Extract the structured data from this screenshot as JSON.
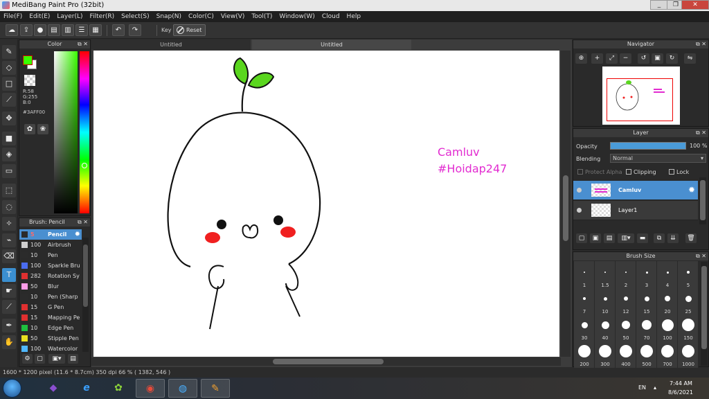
{
  "window": {
    "title": "MediBang Paint Pro (32bit)",
    "controls": [
      "_",
      "❐",
      "✕"
    ]
  },
  "menu": [
    "File(F)",
    "Edit(E)",
    "Layer(L)",
    "Filter(R)",
    "Select(S)",
    "Snap(N)",
    "Color(C)",
    "View(V)",
    "Tool(T)",
    "Window(W)",
    "Cloud",
    "Help"
  ],
  "toolbar": {
    "key_label": "Key",
    "reset_label": "Reset"
  },
  "color_panel": {
    "title": "Color",
    "r": "R:58",
    "g": "G:255",
    "b": "B:0",
    "hex": "#3AFF00",
    "fg_color": "#3aff00"
  },
  "brush_panel": {
    "title": "Brush: Pencil",
    "items": [
      {
        "size": "5",
        "name": "Pencil",
        "color": "#2b2b2b",
        "selected": true
      },
      {
        "size": "100",
        "name": "Airbrush",
        "color": "#cfcfcf"
      },
      {
        "size": "10",
        "name": "Pen",
        "color": "#2b2b2b"
      },
      {
        "size": "100",
        "name": "Sparkle Bru",
        "color": "#4a6cf0"
      },
      {
        "size": "282",
        "name": "Rotation Sy",
        "color": "#e03030"
      },
      {
        "size": "50",
        "name": "Blur",
        "color": "#ff9de8"
      },
      {
        "size": "10",
        "name": "Pen (Sharp",
        "color": "#2b2b2b"
      },
      {
        "size": "15",
        "name": "G Pen",
        "color": "#e03030"
      },
      {
        "size": "15",
        "name": "Mapping Pe",
        "color": "#e03030"
      },
      {
        "size": "10",
        "name": "Edge Pen",
        "color": "#1fbf3f"
      },
      {
        "size": "50",
        "name": "Stipple Pen",
        "color": "#e8e020"
      },
      {
        "size": "100",
        "name": "Watercolor",
        "color": "#4fb8ff"
      }
    ]
  },
  "tabs": [
    {
      "label": "Untitled",
      "active": false
    },
    {
      "label": "Untitled",
      "active": true
    }
  ],
  "canvas_text": {
    "line1": "Camluv",
    "line2": "#Hoidap247"
  },
  "navigator": {
    "title": "Navigator"
  },
  "layer_panel": {
    "title": "Layer",
    "opacity_label": "Opacity",
    "opacity_value": "100 %",
    "opacity": 1.0,
    "blending_label": "Blending",
    "blending_value": "Normal",
    "protect_alpha": "Protect Alpha",
    "clipping": "Clipping",
    "lock": "Lock",
    "layers": [
      {
        "name": "Camluv",
        "selected": true
      },
      {
        "name": "Layer1",
        "selected": false
      }
    ]
  },
  "brush_size_panel": {
    "title": "Brush Size",
    "sizes": [
      "1",
      "1.5",
      "2",
      "3",
      "4",
      "5",
      "7",
      "10",
      "12",
      "15",
      "20",
      "25",
      "30",
      "40",
      "50",
      "70",
      "100",
      "150",
      "200",
      "300",
      "400",
      "500",
      "700",
      "1000"
    ]
  },
  "status": {
    "text": "1600 * 1200 pixel   (11.6 * 8.7cm)   350 dpi   66 %   ( 1382, 546 )"
  },
  "taskbar": {
    "lang": "EN",
    "time": "7:44 AM",
    "date": "8/6/2021"
  },
  "colors": {
    "accent": "#4a8fd0",
    "canvas_text": "#e22bd0",
    "sprout": "#5ad61e",
    "cheek": "#f02020"
  }
}
